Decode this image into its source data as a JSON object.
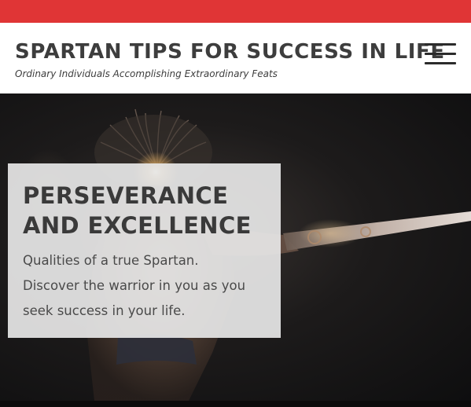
{
  "header": {
    "site_title": "SPARTAN TIPS FOR SUCCESS IN LIFE",
    "tagline": "Ordinary Individuals Accomplishing Extraordinary Feats",
    "menu_icon": "hamburger-menu-icon"
  },
  "hero": {
    "heading_line1": "PERSEVERANCE",
    "heading_line2": "AND EXCELLENCE",
    "text_line1": "Qualities of a true Spartan.",
    "text_line2": "Discover the warrior in you as you",
    "text_line3": "seek success in your life."
  },
  "colors": {
    "top_bar": "#e03536",
    "title_text": "#3d3d3d",
    "hero_box": "#e6e6e6"
  }
}
